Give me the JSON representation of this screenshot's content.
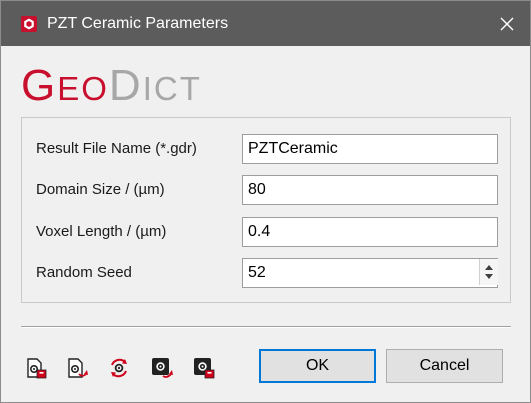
{
  "window": {
    "title": "PZT Ceramic Parameters",
    "close_icon": "close-icon"
  },
  "logo": {
    "geo_first": "G",
    "geo_rest": "EO",
    "dict_first": "D",
    "dict_rest": "ICT",
    "colors": {
      "geo": "#c8102e",
      "dict": "#a7a7a7"
    }
  },
  "form": {
    "result_file": {
      "label": "Result File Name (*.gdr)",
      "value": "PZTCeramic"
    },
    "domain_size": {
      "label": "Domain Size / (µm)",
      "value": "80"
    },
    "voxel_length": {
      "label": "Voxel Length / (µm)",
      "value": "0.4"
    },
    "random_seed": {
      "label": "Random Seed",
      "value": "52"
    }
  },
  "toolbar": {
    "icons": [
      "load-settings-icon",
      "save-settings-icon",
      "reset-settings-icon",
      "record-macro-icon",
      "lock-settings-icon"
    ]
  },
  "buttons": {
    "ok": "OK",
    "cancel": "Cancel"
  }
}
